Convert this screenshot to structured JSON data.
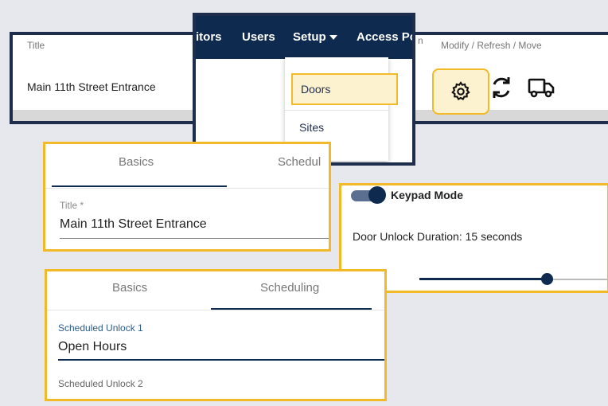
{
  "table": {
    "headers": {
      "title": "Title",
      "actions": "Modify / Refresh / Move"
    },
    "rows": [
      {
        "title": "Main 11th Street Entrance"
      }
    ],
    "icons": {
      "modify": "gear-icon",
      "refresh": "refresh-icon",
      "move": "truck-icon"
    }
  },
  "nav": {
    "items": [
      "itors",
      "Users",
      "Setup",
      "Access Po"
    ],
    "hidden_suffix": "n",
    "dropdown": {
      "items": [
        "Doors",
        "Sites"
      ],
      "selected": "Doors"
    }
  },
  "door_form": {
    "tabs": [
      "Basics",
      "Schedul"
    ],
    "active_tab": "Basics",
    "title_label": "Title *",
    "title_value": "Main 11th Street Entrance"
  },
  "keypad": {
    "toggle_label": "Keypad Mode",
    "toggle_on": true,
    "duration_label": "Door Unlock Duration: 15 seconds",
    "duration_value": 15
  },
  "scheduling": {
    "tabs": [
      "Basics",
      "Scheduling"
    ],
    "active_tab": "Scheduling",
    "unlock1_label": "Scheduled Unlock 1",
    "unlock1_value": "Open Hours",
    "unlock2_label": "Scheduled Unlock 2"
  },
  "colors": {
    "navy": "#0f2a4f",
    "highlight": "#f2b928",
    "highlight_fill": "#fdf2d0"
  }
}
